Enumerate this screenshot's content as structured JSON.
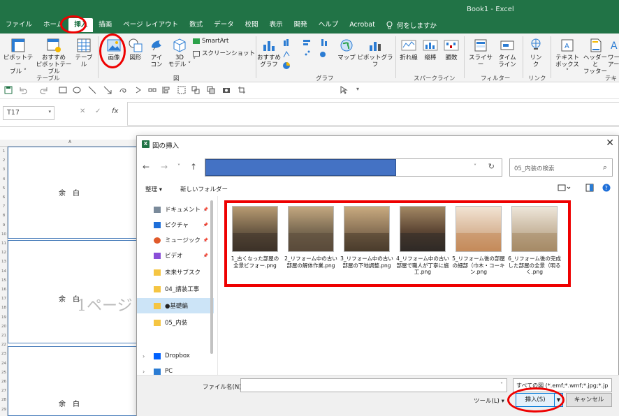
{
  "app": {
    "doc_title": "Book1  -  Excel"
  },
  "menu": {
    "tabs": [
      "ファイル",
      "ホーム",
      "挿入",
      "描画",
      "ページ レイアウト",
      "数式",
      "データ",
      "校閲",
      "表示",
      "開発",
      "ヘルプ",
      "Acrobat"
    ],
    "active_tab": "挿入",
    "tell_me": "何をしますか"
  },
  "ribbon": {
    "pivot_table": "ピボットテー\nブル ˅",
    "recommended_pivot": "おすすめ\nピボットテーブル",
    "table": "テーブル",
    "group_table": "テーブル",
    "picture": "画像",
    "shapes": "図形",
    "icons": "アイ\nコン",
    "models_3d": "3D\nモデル ˅",
    "smartart": "SmartArt",
    "screenshot": "スクリーンショット ˅",
    "group_illustrations": "図",
    "recommended_charts": "おすすめ\nグラフ",
    "maps": "マップ",
    "pivot_chart": "ピボットグラフ",
    "group_charts": "グラフ",
    "line_spark": "折れ線",
    "column_spark": "縦棒",
    "winloss_spark": "勝敗",
    "group_sparklines": "スパークライン",
    "slicer": "スライサー",
    "timeline": "タイム\nライン",
    "group_filters": "フィルター",
    "link": "リン\nク",
    "group_links": "リンク",
    "textbox": "テキスト\nボックス ˅",
    "header_footer": "ヘッダーと\nフッター",
    "wordart": "ワー\nアー",
    "group_text": "テキ"
  },
  "formula_bar": {
    "name_box": "T17",
    "fx": "fx"
  },
  "sheet": {
    "column_a": "A",
    "yohaku": "余　白",
    "page_watermark": "1ページ",
    "row_numbers": [
      "1",
      "2",
      "3",
      "4",
      "5",
      "6",
      "7",
      "8",
      "9",
      "10",
      "11",
      "12",
      "13",
      "14",
      "15",
      "16",
      "17",
      "18",
      "19",
      "20",
      "21",
      "22",
      "23",
      "24",
      "25",
      "26",
      "27",
      "28",
      "29"
    ]
  },
  "dialog": {
    "title": "図の挿入",
    "search_placeholder": "05_内装の検索",
    "organize": "整理 ▾",
    "new_folder": "新しいフォルダー",
    "nav_items": [
      {
        "label": "ドキュメント",
        "pinned": true
      },
      {
        "label": "ピクチャ",
        "pinned": true
      },
      {
        "label": "ミュージック",
        "pinned": true
      },
      {
        "label": "ビデオ",
        "pinned": true
      },
      {
        "label": "未来サブスク",
        "pinned": false
      },
      {
        "label": "04_請装工事",
        "pinned": false
      },
      {
        "label": "●基礎編",
        "pinned": false
      },
      {
        "label": "05_内装",
        "pinned": false
      },
      {
        "label": "Dropbox",
        "pinned": false
      },
      {
        "label": "PC",
        "pinned": false
      }
    ],
    "files": [
      {
        "name": "1_古くなった部屋の全景ビフォー.png"
      },
      {
        "name": "2_リフォーム中の古い部屋の解体作業.png"
      },
      {
        "name": "3_リフォーム中の古い部屋の下地調整.png"
      },
      {
        "name": "4_リフォーム中の古い部屋で職人が丁寧に施工.png"
      },
      {
        "name": "5_リフォーム後の部屋の細部（巾木・コーキン.png"
      },
      {
        "name": "6_リフォーム後の完成した部屋の全景（明るく.png"
      }
    ],
    "file_name_label": "ファイル名(N):",
    "file_name_value": "",
    "file_type": "すべての図 (*.emf;*.wmf;*.jpg;*.jp",
    "tools": "ツール(L)  ▾",
    "insert": "挿入(S)",
    "cancel": "キャンセル"
  }
}
